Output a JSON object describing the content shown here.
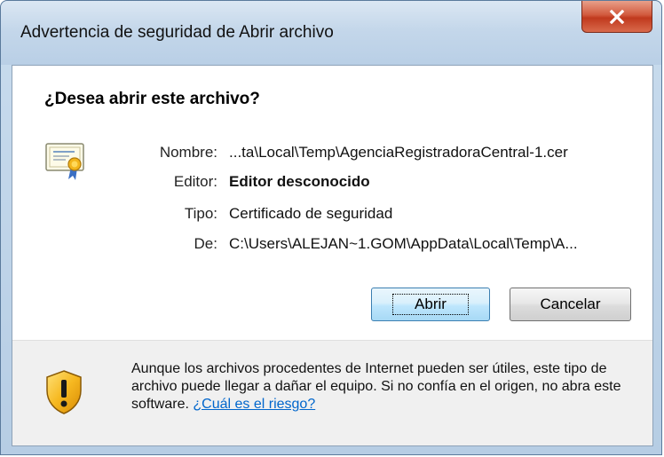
{
  "window": {
    "title": "Advertencia de seguridad de Abrir archivo",
    "close_glyph": "X"
  },
  "dialog": {
    "question": "¿Desea abrir este archivo?",
    "fields": {
      "name_label": "Nombre:",
      "name_value": "...ta\\Local\\Temp\\AgenciaRegistradoraCentral-1.cer",
      "editor_label": "Editor:",
      "editor_value": "Editor desconocido",
      "type_label": "Tipo:",
      "type_value": "Certificado de seguridad",
      "from_label": "De:",
      "from_value": "C:\\Users\\ALEJAN~1.GOM\\AppData\\Local\\Temp\\A..."
    },
    "buttons": {
      "open": "Abrir",
      "cancel": "Cancelar"
    }
  },
  "footer": {
    "warning_text": "Aunque los archivos procedentes de Internet pueden ser útiles, este tipo de archivo puede llegar a dañar el equipo. Si no confía en el origen, no abra este software.",
    "risk_link": "¿Cuál es el riesgo?"
  },
  "icons": {
    "file": "certificate-icon",
    "warning": "shield-warning-icon",
    "close": "close-icon"
  }
}
